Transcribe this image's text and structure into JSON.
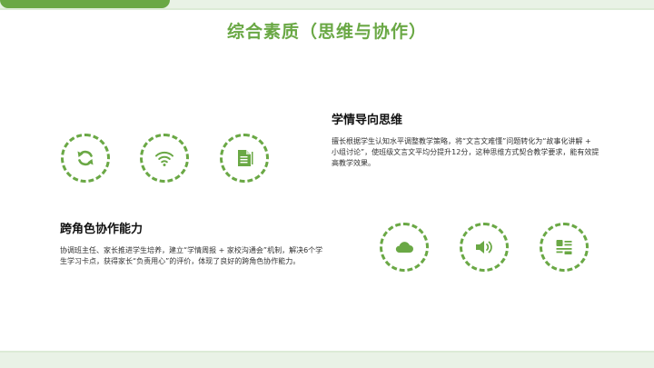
{
  "slide": {
    "title": "综合素质（思维与协作）"
  },
  "sections": [
    {
      "heading": "学情导向思维",
      "body": "擅长根据学生认知水平调整教学策略，将“文言文难懂”问题转化为“故事化讲解 + 小组讨论”，使班级文言文平均分提升12分，这种思维方式契合教学要求，能有效提高教学效果。"
    },
    {
      "heading": "跨角色协作能力",
      "body": "协调班主任、家长推进学生培养，建立“学情周报 + 家校沟通会”机制，解决6个学生学习卡点，获得家长“负责用心”的评价，体现了良好的跨角色协作能力。"
    }
  ],
  "icons": {
    "row1": [
      "refresh-icon",
      "wifi-icon",
      "document-icon"
    ],
    "row2": [
      "cloud-icon",
      "speaker-icon",
      "list-layout-icon"
    ]
  },
  "colors": {
    "accent": "#6aa845",
    "band": "#e9f2e6"
  }
}
